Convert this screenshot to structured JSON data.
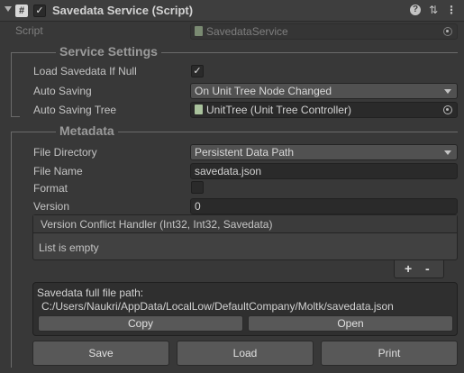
{
  "header": {
    "title": "Savedata Service (Script)",
    "enabled": "✓",
    "icons": [
      "help-icon",
      "presets-icon",
      "more-icon"
    ]
  },
  "script": {
    "label": "Script",
    "value": "SavedataService"
  },
  "service_settings": {
    "title": "Service Settings",
    "load_if_null": {
      "label": "Load Savedata If Null",
      "checked": "✓"
    },
    "auto_saving": {
      "label": "Auto Saving",
      "value": "On Unit Tree Node Changed"
    },
    "auto_saving_tree": {
      "label": "Auto Saving Tree",
      "value": "UnitTree (Unit Tree Controller)"
    }
  },
  "metadata": {
    "title": "Metadata",
    "file_directory": {
      "label": "File Directory",
      "value": "Persistent Data Path"
    },
    "file_name": {
      "label": "File Name",
      "value": "savedata.json"
    },
    "format": {
      "label": "Format",
      "checked": ""
    },
    "version": {
      "label": "Version",
      "value": "0"
    },
    "conflict_handler": {
      "header": "Version Conflict Handler (Int32, Int32, Savedata)",
      "empty_text": "List is empty",
      "add": "+",
      "remove": "-"
    }
  },
  "path_info": {
    "label": "Savedata full file path:",
    "path": "C:/Users/Naukri/AppData/LocalLow/DefaultCompany/Moltk/savedata.json",
    "copy_label": "Copy",
    "open_label": "Open"
  },
  "actions": {
    "save_label": "Save",
    "load_label": "Load",
    "print_label": "Print"
  },
  "colors": {
    "background": "#383838",
    "field": "#2a2a2a",
    "button": "#585858",
    "object_icon": "#a9c29c"
  }
}
